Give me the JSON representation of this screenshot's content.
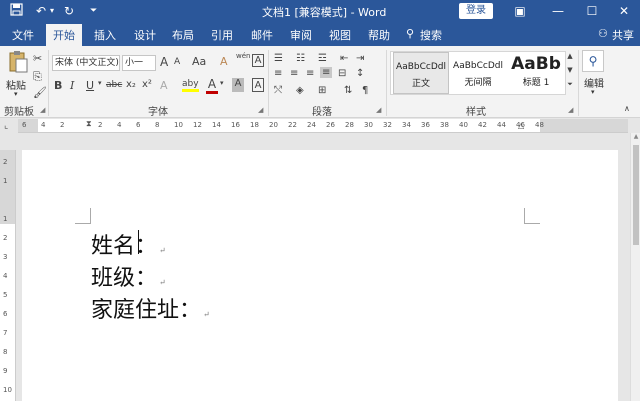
{
  "window": {
    "title": "文档1 [兼容模式] - Word",
    "login_label": "登录"
  },
  "quick_access": {
    "save_icon": "floppy-disk-icon",
    "undo_icon": "undo-icon",
    "redo_icon": "redo-icon",
    "customize_icon": "customize-icon"
  },
  "window_controls": {
    "ribbon_options": "▣",
    "minimize": "—",
    "maximize": "☐",
    "close": "✕"
  },
  "tabs": [
    {
      "label": "文件"
    },
    {
      "label": "开始",
      "active": true
    },
    {
      "label": "插入"
    },
    {
      "label": "设计"
    },
    {
      "label": "布局"
    },
    {
      "label": "引用"
    },
    {
      "label": "邮件"
    },
    {
      "label": "审阅"
    },
    {
      "label": "视图"
    },
    {
      "label": "帮助"
    }
  ],
  "search": {
    "icon": "lightbulb-icon",
    "label": "搜索"
  },
  "share": {
    "label": "共享"
  },
  "clipboard": {
    "paste_label": "粘贴",
    "group_label": "剪贴板"
  },
  "font": {
    "family": "宋体 (中文正文)",
    "size": "小一",
    "group_label": "字体",
    "grow": "A",
    "shrink": "A",
    "change_case": "Aa",
    "clear_format": "A",
    "phonetic": "wén",
    "border": "A",
    "bold": "B",
    "italic": "I",
    "underline": "U",
    "strikethrough": "abc",
    "subscript": "x₂",
    "superscript": "x²",
    "text_effects": "A",
    "highlight": "aby",
    "font_color": "A",
    "shading": "A",
    "char_border": "A"
  },
  "paragraph": {
    "group_label": "段落"
  },
  "styles": {
    "group_label": "样式",
    "items": [
      {
        "preview": "AaBbCcDdl",
        "name": "正文",
        "selected": true
      },
      {
        "preview": "AaBbCcDdl",
        "name": "无间隔"
      },
      {
        "preview": "AaBb",
        "name": "标题 1"
      }
    ]
  },
  "editing": {
    "label": "编辑"
  },
  "ruler": {
    "numbers": [
      "6",
      "4",
      "2",
      "",
      "2",
      "4",
      "6",
      "8",
      "10",
      "12",
      "14",
      "16",
      "18",
      "20",
      "22",
      "24",
      "26",
      "28",
      "30",
      "32",
      "34",
      "36",
      "38",
      "40",
      "42",
      "44",
      "46",
      "48"
    ]
  },
  "vruler": {
    "numbers": [
      "2",
      "1",
      "",
      "1",
      "2",
      "3",
      "4",
      "5",
      "6",
      "7",
      "8",
      "9",
      "10"
    ]
  },
  "document": {
    "lines": [
      {
        "text": "姓名："
      },
      {
        "text": "班级："
      },
      {
        "text": "家庭住址："
      }
    ],
    "paragraph_mark": "↵"
  },
  "colors": {
    "accent": "#2b579a",
    "font_color_bar": "#c00000",
    "highlight_bar": "#ffff00"
  }
}
